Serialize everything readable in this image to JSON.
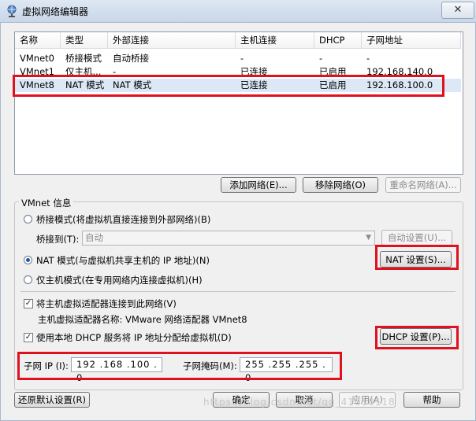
{
  "window": {
    "title": "虚拟网络编辑器",
    "close_glyph": "✕"
  },
  "table": {
    "columns": [
      "名称",
      "类型",
      "外部连接",
      "主机连接",
      "DHCP",
      "子网地址"
    ],
    "rows": [
      [
        "VMnet0",
        "桥接模式",
        "自动桥接",
        "-",
        "-",
        "-"
      ],
      [
        "VMnet1",
        "仅主机...",
        "-",
        "已连接",
        "已启用",
        "192.168.140.0"
      ],
      [
        "VMnet8",
        "NAT 模式",
        "NAT 模式",
        "已连接",
        "已启用",
        "192.168.100.0"
      ]
    ]
  },
  "buttons": {
    "add_network": "添加网络(E)...",
    "remove_network": "移除网络(O)",
    "rename_network": "重命名网络(A)...",
    "auto_settings": "自动设置(U)...",
    "nat_settings": "NAT 设置(S)...",
    "dhcp_settings": "DHCP 设置(P)...",
    "restore_defaults": "还原默认设置(R)",
    "ok": "确定",
    "cancel": "取消",
    "apply": "应用(A)",
    "help": "帮助"
  },
  "vmnet_info": {
    "group_label": "VMnet 信息",
    "bridged_label": "桥接模式(将虚拟机直接连接到外部网络)(B)",
    "bridged_to_label": "桥接到(T):",
    "bridged_to_value": "自动",
    "nat_label": "NAT 模式(与虚拟机共享主机的 IP 地址)(N)",
    "hostonly_label": "仅主机模式(在专用网络内连接虚拟机)(H)",
    "connect_adapter_label": "将主机虚拟适配器连接到此网络(V)",
    "adapter_name_label": "主机虚拟适配器名称: VMware 网络适配器 VMnet8",
    "use_dhcp_label": "使用本地 DHCP 服务将 IP 地址分配给虚拟机(D)",
    "subnet_ip_label": "子网 IP (I):",
    "subnet_ip_value": "192 .168 .100 . 0",
    "subnet_mask_label": "子网掩码(M):",
    "subnet_mask_value": "255 .255 .255 . 0",
    "selected_mode": "nat",
    "connect_adapter_checked": true,
    "use_dhcp_checked": true
  },
  "watermark": "https://blog.csdn.net/qq_41010118",
  "colors": {
    "highlight": "#e0101e",
    "selected_row": "#dde8f7"
  }
}
